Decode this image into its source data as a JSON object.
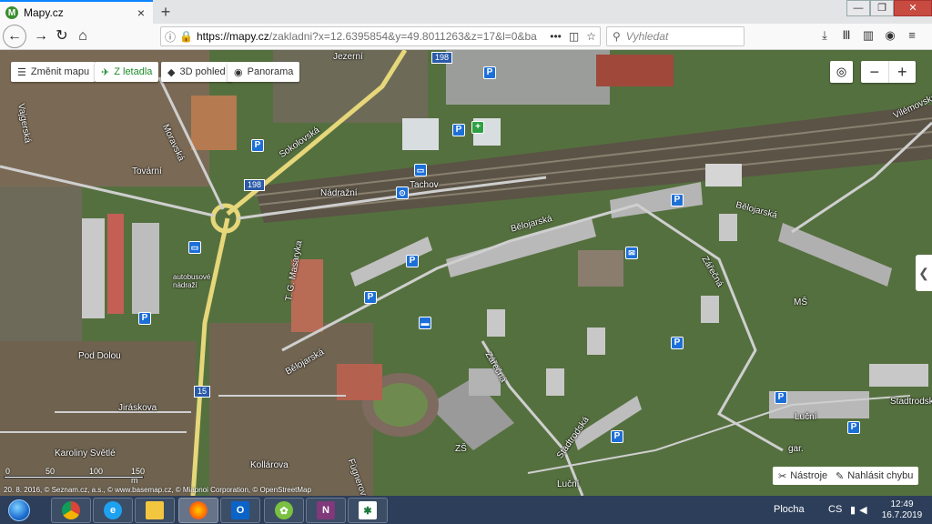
{
  "browser": {
    "tab_title": "Mapy.cz",
    "tab_favicon_letter": "M",
    "url_host": "https://mapy.cz",
    "url_path": "/zakladni?x=12.6395854&y=49.8011263&z=17&l=0&ba",
    "search_placeholder": "Vyhledat",
    "window_controls": [
      "—",
      "❐",
      "✕"
    ]
  },
  "map": {
    "toolbar": {
      "change_map": "Změnit mapu",
      "aerial": "Z letadla",
      "view_3d": "3D pohled",
      "panorama": "Panorama"
    },
    "zoom_in": "+",
    "zoom_out": "−",
    "tools_label": "Nástroje",
    "report_label": "Nahlásit chybu",
    "scale_labels": [
      "0",
      "50",
      "100",
      "150 m"
    ],
    "copyright": "20. 8. 2016, © Seznam.cz, a.s., © www.basemap.cz, © Miapnoi Corporation, © OpenStreetMap",
    "streets": {
      "jezerni": "Jezerní",
      "vajgerska": "Vajgerská",
      "moravska": "Moravská",
      "sokolovska": "Sokolovská",
      "tovarni": "Tovární",
      "nadrazni": "Nádražní",
      "tachov": "Tachov",
      "belojarska1": "Bělojarská",
      "belojarska2": "Bělojarská",
      "belojarska3": "Bělojarská",
      "tgm": "T. G. Masaryka",
      "zarecna1": "Zářečná",
      "zarecna2": "Zářečná",
      "pod_dolou": "Pod Dolou",
      "jiraskova": "Jiráskova",
      "karoliny": "Karoliny Světlé",
      "kollarova": "Kollárova",
      "fugnerova": "Fügnerova",
      "lucni1": "Luční",
      "lucni2": "Luční",
      "stadtrodska1": "Stadtrodská",
      "stadtrodska2": "Stadtrodská",
      "vilemovska": "Vilémovská",
      "autobusove": "autobusové nádraží",
      "zs": "ZŠ",
      "ms": "MŠ",
      "gar": "gar."
    },
    "road_signs": [
      "198",
      "198",
      "15"
    ]
  },
  "taskbar": {
    "desktop_label": "Plocha",
    "lang": "CS",
    "time": "12:49",
    "date": "16.7.2019"
  }
}
